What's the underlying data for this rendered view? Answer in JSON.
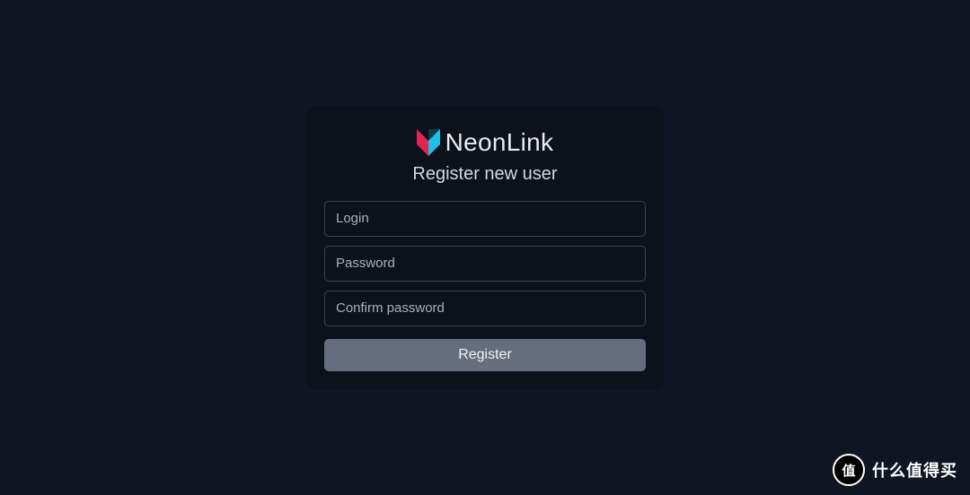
{
  "brand": {
    "name": "NeonLink",
    "logo_colors": {
      "left": "#e0264e",
      "right": "#1fc0e6"
    }
  },
  "form": {
    "title": "Register new user",
    "login_placeholder": "Login",
    "password_placeholder": "Password",
    "confirm_password_placeholder": "Confirm password",
    "submit_label": "Register"
  },
  "watermark": {
    "badge_char": "值",
    "text": "什么值得买"
  },
  "colors": {
    "page_bg": "#0f1621",
    "card_bg": "#0c111a",
    "input_border": "#3a4354",
    "button_bg": "#666d7d"
  }
}
